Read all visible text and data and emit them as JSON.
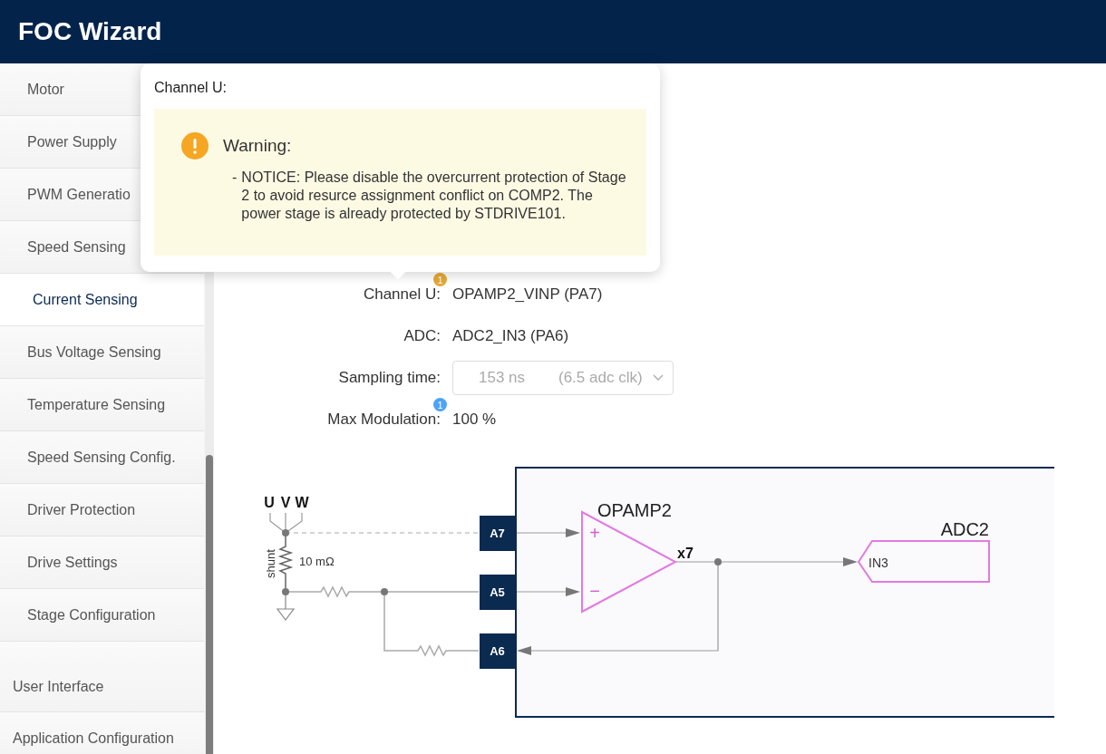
{
  "header": {
    "title": "FOC Wizard"
  },
  "sidebar": {
    "sub_items": [
      {
        "label": "Motor",
        "selected": false
      },
      {
        "label": "Power Supply",
        "selected": false
      },
      {
        "label": "PWM Generatio",
        "selected": false
      },
      {
        "label": "Speed Sensing",
        "selected": false
      },
      {
        "label": "Current Sensing",
        "selected": true
      },
      {
        "label": "Bus Voltage Sensing",
        "selected": false
      },
      {
        "label": "Temperature Sensing",
        "selected": false
      },
      {
        "label": "Speed Sensing Config.",
        "selected": false
      },
      {
        "label": "Driver Protection",
        "selected": false
      },
      {
        "label": "Drive Settings",
        "selected": false
      },
      {
        "label": "Stage Configuration",
        "selected": false
      }
    ],
    "items": [
      {
        "label": "User Interface",
        "selected": false
      },
      {
        "label": "Application Configuration",
        "selected": false
      }
    ]
  },
  "popover": {
    "title": "Channel U:",
    "warning": {
      "title": "Warning:",
      "bullet": "-",
      "messages": [
        "NOTICE: Please disable the overcurrent protection of Stage 2 to avoid resurce assignment conflict on COMP2. The power stage is already protected by STDRIVE101."
      ]
    }
  },
  "fields": [
    {
      "kind": "text",
      "label": "Channel U:",
      "value": "OPAMP2_VINP (PA7)",
      "badge": {
        "text": "1",
        "color": "#e6a935"
      }
    },
    {
      "kind": "text",
      "label": "ADC:",
      "value": "ADC2_IN3 (PA6)"
    },
    {
      "kind": "select",
      "label": "Sampling time:",
      "value": "153 ns",
      "detail": "(6.5 adc clk)",
      "disabled": true
    },
    {
      "kind": "text",
      "label": "Max Modulation:",
      "value": "100 %",
      "badge": {
        "text": "1",
        "color": "#4da3f5"
      }
    }
  ],
  "diagram": {
    "inputs": [
      "U",
      "V",
      "W"
    ],
    "shunt_label": "shunt",
    "shunt_value": "10 mΩ",
    "pins": [
      "A7",
      "A5",
      "A6"
    ],
    "opamp": {
      "name": "OPAMP2",
      "plus": "+",
      "minus": "−",
      "gain": "x7"
    },
    "adc": {
      "name": "ADC2",
      "input": "IN3"
    }
  }
}
